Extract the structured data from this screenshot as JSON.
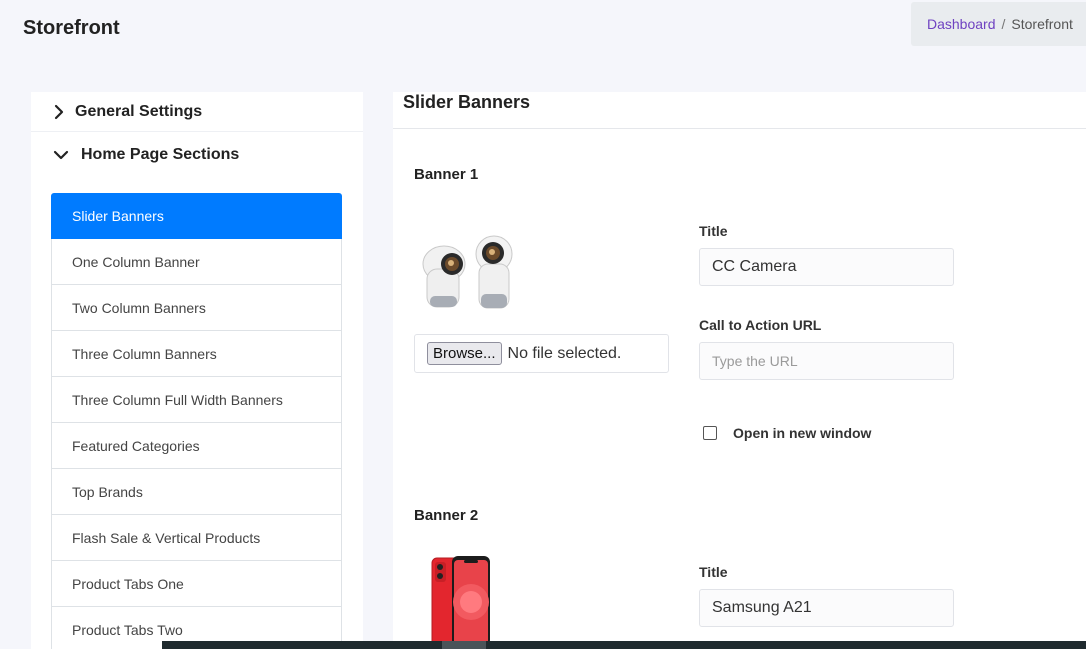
{
  "header": {
    "title": "Storefront",
    "breadcrumb": {
      "link": "Dashboard",
      "separator": "/",
      "current": "Storefront"
    }
  },
  "sidebar": {
    "general_label": "General Settings",
    "home_label": "Home Page Sections",
    "items": [
      {
        "label": "Slider Banners",
        "active": true
      },
      {
        "label": "One Column Banner"
      },
      {
        "label": "Two Column Banners"
      },
      {
        "label": "Three Column Banners"
      },
      {
        "label": "Three Column Full Width Banners"
      },
      {
        "label": "Featured Categories"
      },
      {
        "label": "Top Brands"
      },
      {
        "label": "Flash Sale & Vertical Products"
      },
      {
        "label": "Product Tabs One"
      },
      {
        "label": "Product Tabs Two"
      }
    ]
  },
  "main": {
    "section_title": "Slider Banners",
    "banner1": {
      "heading": "Banner 1",
      "title_label": "Title",
      "title_value": "CC Camera",
      "cta_label": "Call to Action URL",
      "cta_placeholder": "Type the URL",
      "browse_label": "Browse...",
      "file_status": "No file selected.",
      "new_window_label": "Open in new window"
    },
    "banner2": {
      "heading": "Banner 2",
      "title_label": "Title",
      "title_value": "Samsung A21"
    }
  },
  "colors": {
    "accent": "#007bff",
    "breadcrumb_link": "#6f42c1",
    "phone_red": "#e3262e"
  },
  "icons": {
    "chevron_right": "chevron-right-icon",
    "chevron_down": "chevron-down-icon"
  }
}
